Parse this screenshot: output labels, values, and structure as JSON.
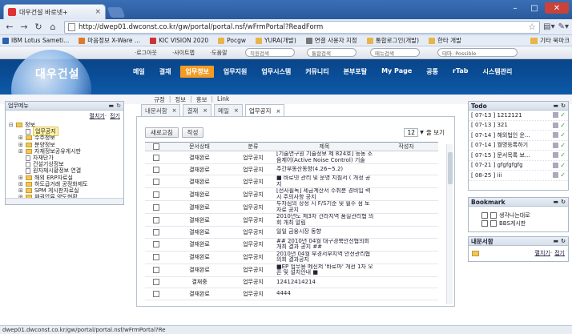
{
  "browser": {
    "tab_title": "대우건설 바로넷+",
    "tab_close": "×",
    "url": "http://dwep01.dwconst.co.kr/gw/portal/portal.nsf/wFrmPortal?ReadForm",
    "window_buttons": [
      "–",
      "□",
      "✕"
    ],
    "nav_icons": [
      "back-arrow-icon",
      "forward-arrow-icon",
      "reload-icon",
      "home-icon"
    ]
  },
  "bookmarks": {
    "items": [
      {
        "label": "IBM Lotus Sameti...",
        "color": "#2a62ad"
      },
      {
        "label": "마음정보 X-Ware ...",
        "color": "#e07a2a"
      },
      {
        "label": "KIC VISION 2020",
        "color": "#c33"
      },
      {
        "label": "Pocgw",
        "color": "#e8b54a"
      },
      {
        "label": "YURA(개발)",
        "color": "#e8b54a"
      },
      {
        "label": "연결 사용자 지정",
        "color": "#777"
      },
      {
        "label": "통합로그인(개발)",
        "color": "#e8b54a"
      },
      {
        "label": "한타 개발",
        "color": "#e8b54a"
      }
    ],
    "other": "기타 북마크"
  },
  "site": {
    "logo": "대우건설",
    "util_links": [
      "·로그아웃",
      "·사이트맵",
      "·도움말"
    ],
    "util_pills": [
      "직원검색",
      "통합검색",
      "메뉴검색",
      "테마: Possible"
    ],
    "main_nav": [
      "메일",
      "결재",
      "업무정보",
      "업무지원",
      "업무시스템",
      "커뮤니티",
      "본부포탈",
      "My Page",
      "공통",
      "rTab",
      "시스템관리"
    ],
    "active_nav_index": 2,
    "sub_nav": [
      "규정",
      "정보",
      "홍보",
      "Link"
    ]
  },
  "left_panel": {
    "title": "업무메뉴",
    "expand_all": "펼치기",
    "collapse_all": "접기",
    "sep": "·",
    "tree": [
      {
        "label": "정보",
        "level": 0,
        "type": "folder",
        "pm": "⊟"
      },
      {
        "label": "업무공지",
        "level": 1,
        "type": "doc",
        "selected": true
      },
      {
        "label": "수주정보",
        "level": 1,
        "type": "folder",
        "pm": "⊞"
      },
      {
        "label": "분양정보",
        "level": 1,
        "type": "folder",
        "pm": "⊞"
      },
      {
        "label": "자재정보공유게시판",
        "level": 1,
        "type": "folder",
        "pm": "⊞"
      },
      {
        "label": "자재단가",
        "level": 1,
        "type": "doc"
      },
      {
        "label": "건설기상정보",
        "level": 1,
        "type": "doc"
      },
      {
        "label": "원자재시황정보 연결",
        "level": 1,
        "type": "doc"
      },
      {
        "label": "해외 ERP자료실",
        "level": 1,
        "type": "folder",
        "pm": "⊞"
      },
      {
        "label": "하도급거래 공정화제도",
        "level": 1,
        "type": "folder",
        "pm": "⊞"
      },
      {
        "label": "SPM 게시판자료실",
        "level": 1,
        "type": "folder",
        "pm": "⊞"
      },
      {
        "label": "채권압류 양도현황",
        "level": 1,
        "type": "folder",
        "pm": "⊞"
      }
    ]
  },
  "center": {
    "tabs": [
      {
        "label": "내문서함",
        "active": false
      },
      {
        "label": "결재",
        "active": false
      },
      {
        "label": "메일",
        "active": false
      },
      {
        "label": "업무공지",
        "active": true
      }
    ],
    "tab_close": "×",
    "buttons": {
      "refresh": "새로고침",
      "write": "작성"
    },
    "page_size": "12",
    "page_size_suffix": "줄 보기",
    "columns": [
      "",
      "문서상태",
      "분류",
      "제목",
      "작성자"
    ],
    "rows": [
      {
        "status": "결재완료",
        "category": "업무공지",
        "title": "[기술연구원 기술정보 제 824호] 능동 소음제어(Active Noise Control) 기술"
      },
      {
        "status": "결재완료",
        "category": "업무공지",
        "title": "주간부동산동향(4.26~5.2)"
      },
      {
        "status": "결재완료",
        "category": "업무공지",
        "title": "■ 바로넷 관리 및 운영 지침서 ( 개정 공지"
      },
      {
        "status": "결재완료",
        "category": "업무공지",
        "title": "[전사필독] 세금계산서 수취분 경비입 력시 주의사항 공지"
      },
      {
        "status": "결재완료",
        "category": "업무공지",
        "title": "투자심의 상정 시 F/S기준 및 필수 점 토자료 공지"
      },
      {
        "status": "결재완료",
        "category": "업무공지",
        "title": "2010년도 제3차 건라지역 품질관리협 의회 개최 알림"
      },
      {
        "status": "결재완료",
        "category": "업무공지",
        "title": "일일 금융시장 동향"
      },
      {
        "status": "결재완료",
        "category": "업무공지",
        "title": "## 2010년 04월 대구경북안전협의회 개최 결과 공지 ##"
      },
      {
        "status": "결재완료",
        "category": "업무공지",
        "title": "2010년 04월 부경서부지역 안전관리협 의회 결과공지"
      },
      {
        "status": "결재완료",
        "category": "업무공지",
        "title": "■EP 업무용 메신저 '바로마' 개선 1차 오픈 및 설치안내 ■"
      },
      {
        "status": "결재중",
        "category": "업무공지",
        "title": "12412414214"
      },
      {
        "status": "결재완료",
        "category": "업무공지",
        "title": "4444"
      }
    ]
  },
  "todo": {
    "title": "Todo",
    "items": [
      {
        "label": "[ 07-13 ] 1212121"
      },
      {
        "label": "[ 07-13 ] 321"
      },
      {
        "label": "[ 07-14 ] 해외법인 운..."
      },
      {
        "label": "[ 07-14 ] 월명등록하기"
      },
      {
        "label": "[ 07-15 ] 문서목록 보..."
      },
      {
        "label": "[ 07-21 ] gfgfgfgfg"
      },
      {
        "label": "[ 08-25 ] iii"
      }
    ]
  },
  "bookmark_panel": {
    "title": "Bookmark",
    "items": [
      "생각나는대로",
      "BBS게시판"
    ]
  },
  "notice_panel": {
    "title": "내문서함",
    "expand_all": "펼치기",
    "collapse_all": "접기",
    "sep": "·"
  },
  "status_bar": "dwep01.dwconst.co.kr/gw/portal/portal.nsf/wFrmPortal?Re"
}
